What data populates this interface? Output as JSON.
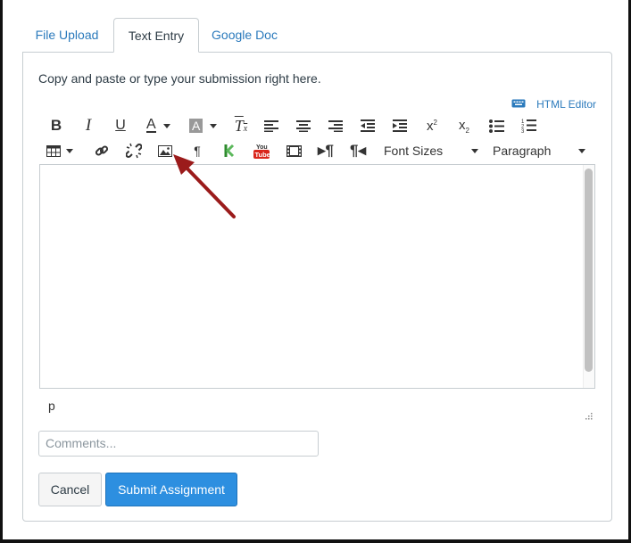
{
  "tabs": [
    {
      "label": "File Upload",
      "active": false
    },
    {
      "label": "Text Entry",
      "active": true
    },
    {
      "label": "Google Doc",
      "active": false
    }
  ],
  "instructions": "Copy and paste or type your submission right here.",
  "html_editor_label": "HTML Editor",
  "toolbar": {
    "row1_icons": [
      "bold-icon",
      "italic-icon",
      "underline-icon",
      "text-color-icon",
      "background-color-icon",
      "clear-formatting-icon",
      "align-left-icon",
      "align-center-icon",
      "align-right-icon",
      "outdent-icon",
      "indent-icon",
      "superscript-icon",
      "subscript-icon",
      "bulleted-list-icon",
      "numbered-list-icon"
    ],
    "row2_icons": [
      "table-icon",
      "link-icon",
      "unlink-icon",
      "embed-image-icon",
      "show-blocks-icon",
      "kaltura-icon",
      "youtube-icon",
      "media-icon",
      "ltr-icon",
      "rtl-icon"
    ],
    "font_sizes_label": "Font Sizes",
    "paragraph_label": "Paragraph"
  },
  "editor": {
    "path_label": "p",
    "content": ""
  },
  "comments": {
    "value": "",
    "placeholder": "Comments..."
  },
  "buttons": {
    "cancel_label": "Cancel",
    "submit_label": "Submit Assignment"
  },
  "colors": {
    "accent": "#2d8fe0",
    "link": "#2b7abc",
    "annotation_arrow": "#9b1b1b",
    "border": "#c7cdd1"
  }
}
